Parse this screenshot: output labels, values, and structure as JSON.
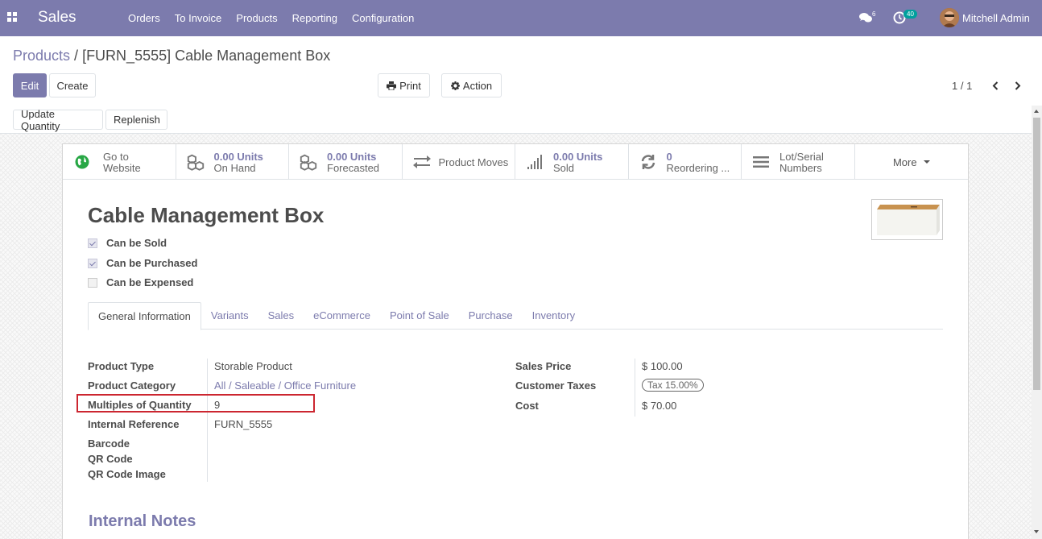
{
  "navbar": {
    "brand": "Sales",
    "menu": [
      "Orders",
      "To Invoice",
      "Products",
      "Reporting",
      "Configuration"
    ],
    "chat_count": "6",
    "activity_count": "40",
    "user": "Mitchell Admin"
  },
  "breadcrumb": {
    "parent": "Products",
    "separator": " / ",
    "current": "[FURN_5555] Cable Management Box"
  },
  "toolbar": {
    "edit": "Edit",
    "create": "Create",
    "print": "Print",
    "action": "Action"
  },
  "pager": {
    "text": "1 / 1"
  },
  "status_buttons": {
    "update_quantity": "Update Quantity",
    "replenish": "Replenish"
  },
  "smart_buttons": [
    {
      "value": "",
      "label": "Go to",
      "label2": "Website",
      "icon": "globe-icon"
    },
    {
      "value": "0.00 Units",
      "label": "On Hand",
      "icon": "cubes-icon"
    },
    {
      "value": "0.00 Units",
      "label": "Forecasted",
      "icon": "cubes-icon"
    },
    {
      "value": "",
      "label": "Product Moves",
      "icon": "exchange-icon"
    },
    {
      "value": "0.00 Units",
      "label": "Sold",
      "icon": "bar-chart-icon"
    },
    {
      "value": "0",
      "label": "Reordering ...",
      "icon": "refresh-icon"
    },
    {
      "value": "",
      "label": "Lot/Serial",
      "label2": "Numbers",
      "icon": "bars-icon"
    },
    {
      "more": "More"
    }
  ],
  "product": {
    "name": "Cable Management Box",
    "can_be_sold": {
      "label": "Can be Sold",
      "checked": true
    },
    "can_be_purchased": {
      "label": "Can be Purchased",
      "checked": true
    },
    "can_be_expensed": {
      "label": "Can be Expensed",
      "checked": false
    }
  },
  "tabs": [
    "General Information",
    "Variants",
    "Sales",
    "eCommerce",
    "Point of Sale",
    "Purchase",
    "Inventory"
  ],
  "fields_left": [
    {
      "label": "Product Type",
      "value": "Storable Product"
    },
    {
      "label": "Product Category",
      "value": "All / Saleable / Office Furniture"
    },
    {
      "label": "Multiples of Quantity",
      "value": "9"
    },
    {
      "label": "Internal Reference",
      "value": "FURN_5555"
    },
    {
      "label": "Barcode",
      "value": ""
    },
    {
      "label": "QR Code",
      "value": ""
    },
    {
      "label": "QR Code Image",
      "value": ""
    }
  ],
  "fields_right": [
    {
      "label": "Sales Price",
      "value": "$ 100.00"
    },
    {
      "label": "Customer Taxes",
      "value": "Tax 15.00%"
    },
    {
      "label": "Cost",
      "value": "$ 70.00"
    }
  ],
  "sections": {
    "internal_notes": "Internal Notes"
  },
  "colors": {
    "brand": "#7c7bad",
    "highlight": "#cc2630",
    "badge": "#00a09d"
  }
}
